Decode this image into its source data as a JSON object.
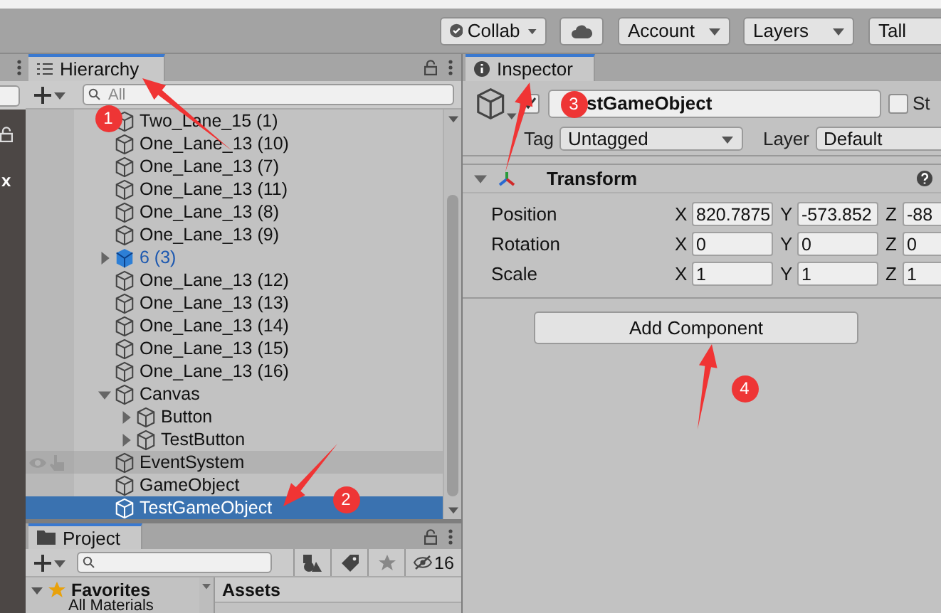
{
  "toolbar": {
    "buttons": [
      {
        "kind": "collab",
        "label": "Collab"
      },
      {
        "kind": "cloud"
      },
      {
        "kind": "dropdown",
        "label": "Account"
      },
      {
        "kind": "dropdown",
        "label": "Layers"
      },
      {
        "kind": "layout",
        "label": "Tall"
      }
    ]
  },
  "left_strip": {
    "text": "x"
  },
  "hierarchy": {
    "tab": {
      "label": "Hierarchy",
      "selected": true
    },
    "search": {
      "placeholder": "All"
    },
    "items": [
      {
        "label": "Two_Lane_15 (1)",
        "kind": "object",
        "selected": false,
        "hovered": false
      },
      {
        "label": "One_Lane_13 (10)",
        "kind": "object",
        "selected": false,
        "hovered": false
      },
      {
        "label": "One_Lane_13 (7)",
        "kind": "object",
        "selected": false,
        "hovered": false
      },
      {
        "label": "One_Lane_13 (11)",
        "kind": "object",
        "selected": false,
        "hovered": false
      },
      {
        "label": "One_Lane_13 (8)",
        "kind": "object",
        "selected": false,
        "hovered": false
      },
      {
        "label": "One_Lane_13 (9)",
        "kind": "object",
        "selected": false,
        "hovered": false
      },
      {
        "label": "6 (3)",
        "kind": "prefab",
        "expanded": false,
        "selected": false,
        "hovered": false
      },
      {
        "label": "One_Lane_13 (12)",
        "kind": "object",
        "selected": false,
        "hovered": false
      },
      {
        "label": "One_Lane_13 (13)",
        "kind": "object",
        "selected": false,
        "hovered": false
      },
      {
        "label": "One_Lane_13 (14)",
        "kind": "object",
        "selected": false,
        "hovered": false
      },
      {
        "label": "One_Lane_13 (15)",
        "kind": "object",
        "selected": false,
        "hovered": false
      },
      {
        "label": "One_Lane_13 (16)",
        "kind": "object",
        "selected": false,
        "hovered": false
      },
      {
        "label": "Canvas",
        "kind": "object",
        "expanded": true,
        "selected": false,
        "hovered": false,
        "children": [
          {
            "label": "Button",
            "kind": "object",
            "expanded": false,
            "selected": false,
            "hovered": false
          },
          {
            "label": "TestButton",
            "kind": "object",
            "expanded": false,
            "selected": false,
            "hovered": false
          }
        ]
      },
      {
        "label": "EventSystem",
        "kind": "object",
        "selected": false,
        "hovered": true
      },
      {
        "label": "GameObject",
        "kind": "object",
        "selected": false,
        "hovered": false
      },
      {
        "label": "TestGameObject",
        "kind": "object",
        "selected": true,
        "hovered": false
      }
    ]
  },
  "project": {
    "tab": {
      "label": "Project",
      "selected": true
    },
    "hidden_count": "16",
    "favorites": {
      "label": "Favorites",
      "expanded": true,
      "children": [
        {
          "label": "All Materials"
        }
      ]
    },
    "assets_header": "Assets"
  },
  "inspector": {
    "tab": {
      "label": "Inspector",
      "selected": true
    },
    "object": {
      "active": true,
      "name": "stGameObject",
      "static": false,
      "static_label": "St"
    },
    "tag": {
      "label": "Tag",
      "value": "Untagged"
    },
    "layer": {
      "label": "Layer",
      "value": "Default"
    },
    "component": {
      "title": "Transform",
      "expanded": true,
      "properties": [
        {
          "label": "Position",
          "fields": [
            {
              "axis": "X",
              "value": "820.7875"
            },
            {
              "axis": "Y",
              "value": "-573.852"
            },
            {
              "axis": "Z",
              "value": "-88"
            }
          ]
        },
        {
          "label": "Rotation",
          "fields": [
            {
              "axis": "X",
              "value": "0"
            },
            {
              "axis": "Y",
              "value": "0"
            },
            {
              "axis": "Z",
              "value": "0"
            }
          ]
        },
        {
          "label": "Scale",
          "fields": [
            {
              "axis": "X",
              "value": "1"
            },
            {
              "axis": "Y",
              "value": "1"
            },
            {
              "axis": "Z",
              "value": "1"
            }
          ]
        }
      ]
    },
    "add_button": "Add Component"
  },
  "annotations": [
    {
      "number": "1"
    },
    {
      "number": "2"
    },
    {
      "number": "3"
    },
    {
      "number": "4"
    }
  ]
}
